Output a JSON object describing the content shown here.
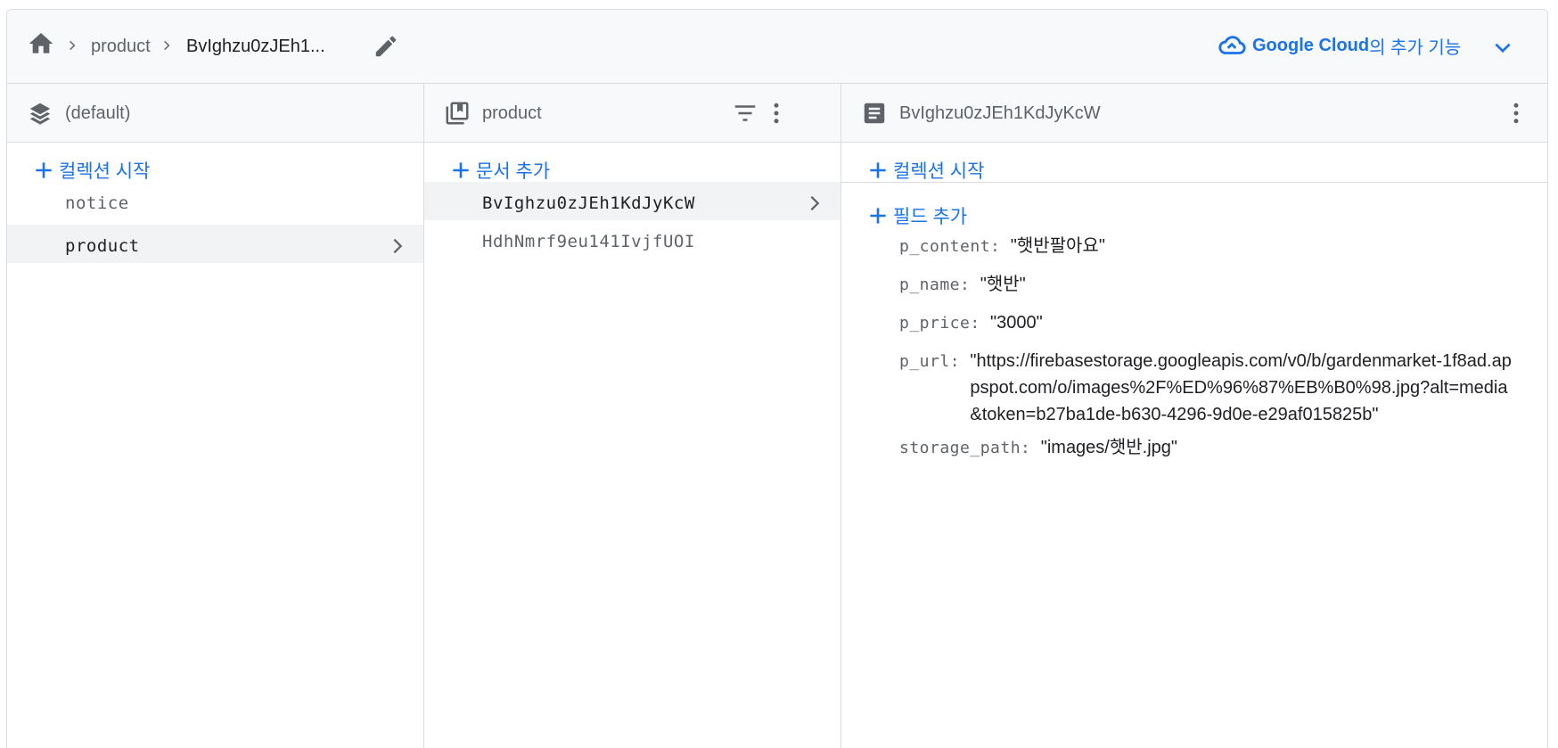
{
  "breadcrumb": {
    "items": [
      "product",
      "BvIghzu0zJEh1..."
    ]
  },
  "google_cloud": {
    "brand": "Google Cloud",
    "suffix": "의 추가 기능"
  },
  "columns": {
    "database": {
      "title": "(default)",
      "add_label": "컬렉션 시작",
      "items": [
        {
          "label": "notice"
        },
        {
          "label": "product"
        }
      ],
      "selected_index": 1
    },
    "collection": {
      "title": "product",
      "add_label": "문서 추가",
      "items": [
        {
          "label": "BvIghzu0zJEh1KdJyKcW"
        },
        {
          "label": "HdhNmrf9eu141IvjfUOI"
        }
      ],
      "selected_index": 0
    },
    "document": {
      "title": "BvIghzu0zJEh1KdJyKcW",
      "add_collection_label": "컬렉션 시작",
      "add_field_label": "필드 추가",
      "fields": [
        {
          "key": "p_content",
          "value": "\"햇반팔아요\""
        },
        {
          "key": "p_name",
          "value": "\"햇반\""
        },
        {
          "key": "p_price",
          "value": "\"3000\""
        },
        {
          "key": "p_url",
          "value": "\"https://firebasestorage.googleapis.com/v0/b/gardenmarket-1f8ad.appspot.com/o/images%2F%ED%96%87%EB%B0%98.jpg?alt=media&token=b27ba1de-b630-4296-9d0e-e29af015825b\""
        },
        {
          "key": "storage_path",
          "value": "\"images/햇반.jpg\""
        }
      ]
    }
  },
  "colors": {
    "accent": "#1a73e8",
    "icon": "#5f6368",
    "selected_bg": "#f1f3f4",
    "header_bg": "#f8f9fa",
    "border": "#dadce0"
  }
}
